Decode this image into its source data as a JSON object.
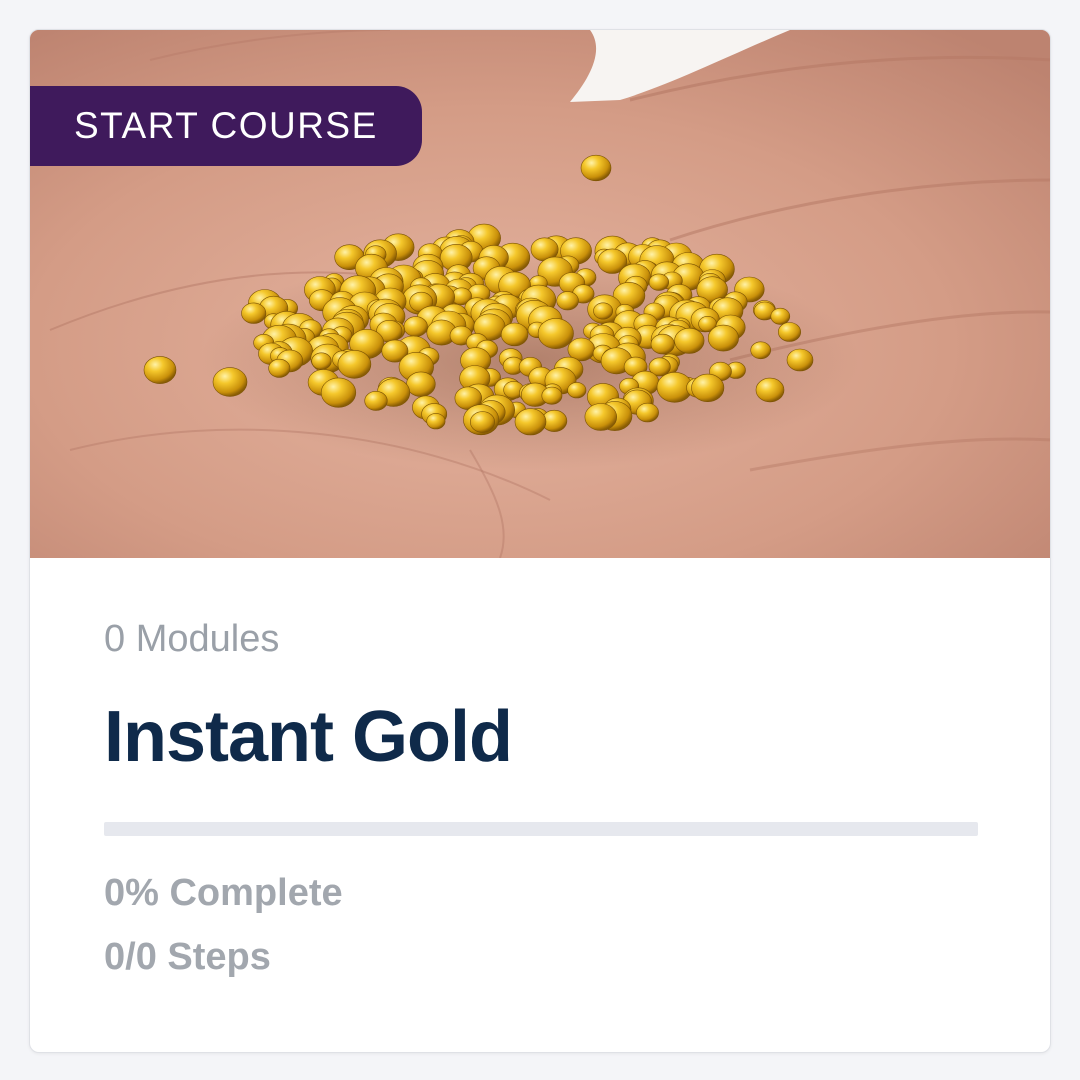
{
  "course": {
    "badge_label": "START COURSE",
    "modules_text": "0 Modules",
    "title": "Instant Gold",
    "progress_fraction": 0,
    "complete_text": "0% Complete",
    "steps_text": "0/0 Steps"
  },
  "colors": {
    "badge_bg": "#3f1a5c",
    "title": "#0f2a4a",
    "muted_text": "#9aa0a8",
    "progress_track": "#e6e8ee"
  },
  "image": {
    "subject": "hand-holding-gold-grains"
  }
}
